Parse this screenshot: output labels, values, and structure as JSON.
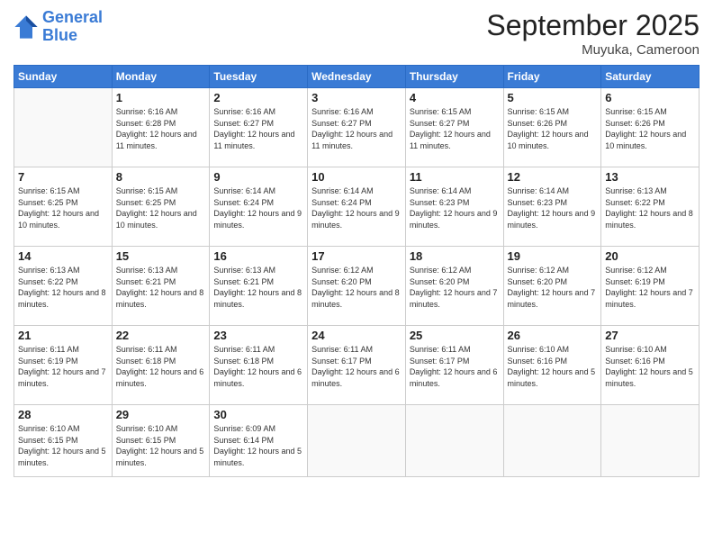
{
  "header": {
    "logo_line1": "General",
    "logo_line2": "Blue",
    "month": "September 2025",
    "location": "Muyuka, Cameroon"
  },
  "days_of_week": [
    "Sunday",
    "Monday",
    "Tuesday",
    "Wednesday",
    "Thursday",
    "Friday",
    "Saturday"
  ],
  "weeks": [
    [
      {
        "day": "",
        "info": ""
      },
      {
        "day": "1",
        "info": "Sunrise: 6:16 AM\nSunset: 6:28 PM\nDaylight: 12 hours and 11 minutes."
      },
      {
        "day": "2",
        "info": "Sunrise: 6:16 AM\nSunset: 6:27 PM\nDaylight: 12 hours and 11 minutes."
      },
      {
        "day": "3",
        "info": "Sunrise: 6:16 AM\nSunset: 6:27 PM\nDaylight: 12 hours and 11 minutes."
      },
      {
        "day": "4",
        "info": "Sunrise: 6:15 AM\nSunset: 6:27 PM\nDaylight: 12 hours and 11 minutes."
      },
      {
        "day": "5",
        "info": "Sunrise: 6:15 AM\nSunset: 6:26 PM\nDaylight: 12 hours and 10 minutes."
      },
      {
        "day": "6",
        "info": "Sunrise: 6:15 AM\nSunset: 6:26 PM\nDaylight: 12 hours and 10 minutes."
      }
    ],
    [
      {
        "day": "7",
        "info": "Sunrise: 6:15 AM\nSunset: 6:25 PM\nDaylight: 12 hours and 10 minutes."
      },
      {
        "day": "8",
        "info": "Sunrise: 6:15 AM\nSunset: 6:25 PM\nDaylight: 12 hours and 10 minutes."
      },
      {
        "day": "9",
        "info": "Sunrise: 6:14 AM\nSunset: 6:24 PM\nDaylight: 12 hours and 9 minutes."
      },
      {
        "day": "10",
        "info": "Sunrise: 6:14 AM\nSunset: 6:24 PM\nDaylight: 12 hours and 9 minutes."
      },
      {
        "day": "11",
        "info": "Sunrise: 6:14 AM\nSunset: 6:23 PM\nDaylight: 12 hours and 9 minutes."
      },
      {
        "day": "12",
        "info": "Sunrise: 6:14 AM\nSunset: 6:23 PM\nDaylight: 12 hours and 9 minutes."
      },
      {
        "day": "13",
        "info": "Sunrise: 6:13 AM\nSunset: 6:22 PM\nDaylight: 12 hours and 8 minutes."
      }
    ],
    [
      {
        "day": "14",
        "info": "Sunrise: 6:13 AM\nSunset: 6:22 PM\nDaylight: 12 hours and 8 minutes."
      },
      {
        "day": "15",
        "info": "Sunrise: 6:13 AM\nSunset: 6:21 PM\nDaylight: 12 hours and 8 minutes."
      },
      {
        "day": "16",
        "info": "Sunrise: 6:13 AM\nSunset: 6:21 PM\nDaylight: 12 hours and 8 minutes."
      },
      {
        "day": "17",
        "info": "Sunrise: 6:12 AM\nSunset: 6:20 PM\nDaylight: 12 hours and 8 minutes."
      },
      {
        "day": "18",
        "info": "Sunrise: 6:12 AM\nSunset: 6:20 PM\nDaylight: 12 hours and 7 minutes."
      },
      {
        "day": "19",
        "info": "Sunrise: 6:12 AM\nSunset: 6:20 PM\nDaylight: 12 hours and 7 minutes."
      },
      {
        "day": "20",
        "info": "Sunrise: 6:12 AM\nSunset: 6:19 PM\nDaylight: 12 hours and 7 minutes."
      }
    ],
    [
      {
        "day": "21",
        "info": "Sunrise: 6:11 AM\nSunset: 6:19 PM\nDaylight: 12 hours and 7 minutes."
      },
      {
        "day": "22",
        "info": "Sunrise: 6:11 AM\nSunset: 6:18 PM\nDaylight: 12 hours and 6 minutes."
      },
      {
        "day": "23",
        "info": "Sunrise: 6:11 AM\nSunset: 6:18 PM\nDaylight: 12 hours and 6 minutes."
      },
      {
        "day": "24",
        "info": "Sunrise: 6:11 AM\nSunset: 6:17 PM\nDaylight: 12 hours and 6 minutes."
      },
      {
        "day": "25",
        "info": "Sunrise: 6:11 AM\nSunset: 6:17 PM\nDaylight: 12 hours and 6 minutes."
      },
      {
        "day": "26",
        "info": "Sunrise: 6:10 AM\nSunset: 6:16 PM\nDaylight: 12 hours and 5 minutes."
      },
      {
        "day": "27",
        "info": "Sunrise: 6:10 AM\nSunset: 6:16 PM\nDaylight: 12 hours and 5 minutes."
      }
    ],
    [
      {
        "day": "28",
        "info": "Sunrise: 6:10 AM\nSunset: 6:15 PM\nDaylight: 12 hours and 5 minutes."
      },
      {
        "day": "29",
        "info": "Sunrise: 6:10 AM\nSunset: 6:15 PM\nDaylight: 12 hours and 5 minutes."
      },
      {
        "day": "30",
        "info": "Sunrise: 6:09 AM\nSunset: 6:14 PM\nDaylight: 12 hours and 5 minutes."
      },
      {
        "day": "",
        "info": ""
      },
      {
        "day": "",
        "info": ""
      },
      {
        "day": "",
        "info": ""
      },
      {
        "day": "",
        "info": ""
      }
    ]
  ]
}
